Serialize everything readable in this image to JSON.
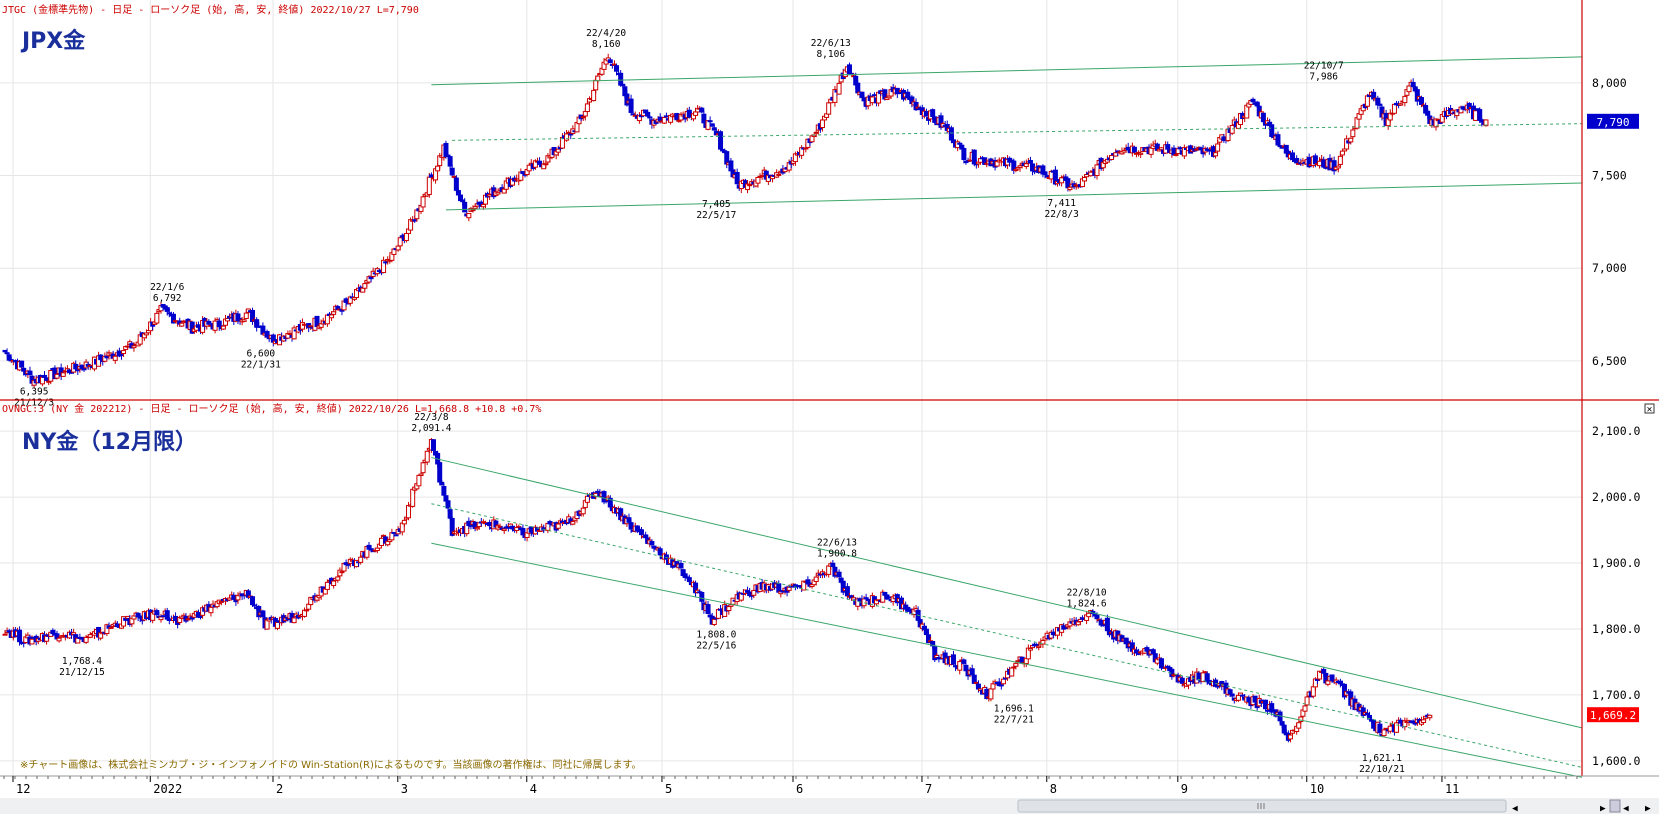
{
  "chart_data": [
    {
      "type": "candlestick",
      "header": "JTGC (金標準先物) - 日足 - ローソク足 (始, 高, 安, 終値)  2022/10/27 L=7,790",
      "title": "JPX金",
      "ylim": [
        6300,
        8350
      ],
      "yticks": [
        "8,000",
        "7,500",
        "7,000",
        "6,500"
      ],
      "ytick_values": [
        8000,
        7500,
        7000,
        6500
      ],
      "last_label": "7,790",
      "last_value": 7790,
      "anchors": [
        {
          "x": 0,
          "y": 6550
        },
        {
          "x": 14,
          "y": 6395
        },
        {
          "x": 40,
          "y": 6480
        },
        {
          "x": 63,
          "y": 6590
        },
        {
          "x": 75,
          "y": 6770
        },
        {
          "x": 90,
          "y": 6680
        },
        {
          "x": 103,
          "y": 6700
        },
        {
          "x": 117,
          "y": 6760
        },
        {
          "x": 128,
          "y": 6620
        },
        {
          "x": 134,
          "y": 6640
        },
        {
          "x": 152,
          "y": 6720
        },
        {
          "x": 166,
          "y": 6820
        },
        {
          "x": 185,
          "y": 7050
        },
        {
          "x": 196,
          "y": 7250
        },
        {
          "x": 211,
          "y": 7650
        },
        {
          "x": 221,
          "y": 7300
        },
        {
          "x": 240,
          "y": 7450
        },
        {
          "x": 262,
          "y": 7600
        },
        {
          "x": 277,
          "y": 7800
        },
        {
          "x": 290,
          "y": 8160
        },
        {
          "x": 301,
          "y": 7850
        },
        {
          "x": 312,
          "y": 7800
        },
        {
          "x": 333,
          "y": 7850
        },
        {
          "x": 343,
          "y": 7700
        },
        {
          "x": 352,
          "y": 7450
        },
        {
          "x": 377,
          "y": 7550
        },
        {
          "x": 391,
          "y": 7750
        },
        {
          "x": 405,
          "y": 8100
        },
        {
          "x": 413,
          "y": 7900
        },
        {
          "x": 430,
          "y": 7950
        },
        {
          "x": 453,
          "y": 7750
        },
        {
          "x": 462,
          "y": 7600
        },
        {
          "x": 495,
          "y": 7540
        },
        {
          "x": 515,
          "y": 7430
        },
        {
          "x": 535,
          "y": 7650
        },
        {
          "x": 560,
          "y": 7640
        },
        {
          "x": 580,
          "y": 7620
        },
        {
          "x": 600,
          "y": 7900
        },
        {
          "x": 617,
          "y": 7600
        },
        {
          "x": 640,
          "y": 7550
        },
        {
          "x": 656,
          "y": 7940
        },
        {
          "x": 664,
          "y": 7800
        },
        {
          "x": 676,
          "y": 7986
        },
        {
          "x": 686,
          "y": 7780
        },
        {
          "x": 700,
          "y": 7870
        },
        {
          "x": 712,
          "y": 7800
        }
      ],
      "annotations": [
        {
          "x": 14,
          "y": 6395,
          "pos": "below",
          "lines": [
            "6,395",
            "21/12/3"
          ]
        },
        {
          "x": 78,
          "y": 6792,
          "pos": "above",
          "lines": [
            "22/1/6",
            "6,792"
          ]
        },
        {
          "x": 123,
          "y": 6600,
          "pos": "below",
          "lines": [
            "6,600",
            "22/1/31"
          ]
        },
        {
          "x": 289,
          "y": 8160,
          "pos": "above",
          "lines": [
            "22/4/20",
            "8,160"
          ]
        },
        {
          "x": 342,
          "y": 7405,
          "pos": "below",
          "lines": [
            "7,405",
            "22/5/17"
          ]
        },
        {
          "x": 397,
          "y": 8106,
          "pos": "above",
          "lines": [
            "22/6/13",
            "8,106"
          ]
        },
        {
          "x": 508,
          "y": 7411,
          "pos": "below",
          "lines": [
            "7,411",
            "22/8/3"
          ]
        },
        {
          "x": 634,
          "y": 7986,
          "pos": "above",
          "lines": [
            "22/10/7",
            "7,986"
          ]
        }
      ]
    },
    {
      "type": "candlestick",
      "header": "OVNGC:3 (NY 金 202212) - 日足 - ローソク足 (始, 高, 安, 終値)  2022/10/26 L=1,668.8 +10.8  +0.7%",
      "title": "NY金（12月限）",
      "ylim": [
        1580,
        2120
      ],
      "yticks": [
        "2,100.0",
        "2,000.0",
        "1,900.0",
        "1,800.0",
        "1,700.0",
        "1,600.0"
      ],
      "ytick_values": [
        2100,
        2000,
        1900,
        1800,
        1700,
        1600
      ],
      "last_label": "1,669.2",
      "last_value": 1669.2,
      "anchors": [
        {
          "x": 0,
          "y": 1800
        },
        {
          "x": 10,
          "y": 1782
        },
        {
          "x": 28,
          "y": 1795
        },
        {
          "x": 38,
          "y": 1782
        },
        {
          "x": 55,
          "y": 1810
        },
        {
          "x": 75,
          "y": 1825
        },
        {
          "x": 83,
          "y": 1808
        },
        {
          "x": 100,
          "y": 1835
        },
        {
          "x": 117,
          "y": 1855
        },
        {
          "x": 125,
          "y": 1805
        },
        {
          "x": 140,
          "y": 1820
        },
        {
          "x": 158,
          "y": 1880
        },
        {
          "x": 175,
          "y": 1920
        },
        {
          "x": 190,
          "y": 1950
        },
        {
          "x": 205,
          "y": 2085
        },
        {
          "x": 215,
          "y": 1950
        },
        {
          "x": 233,
          "y": 1960
        },
        {
          "x": 250,
          "y": 1945
        },
        {
          "x": 270,
          "y": 1960
        },
        {
          "x": 285,
          "y": 2010
        },
        {
          "x": 300,
          "y": 1960
        },
        {
          "x": 312,
          "y": 1925
        },
        {
          "x": 328,
          "y": 1880
        },
        {
          "x": 340,
          "y": 1815
        },
        {
          "x": 353,
          "y": 1850
        },
        {
          "x": 365,
          "y": 1865
        },
        {
          "x": 375,
          "y": 1860
        },
        {
          "x": 385,
          "y": 1865
        },
        {
          "x": 397,
          "y": 1895
        },
        {
          "x": 407,
          "y": 1840
        },
        {
          "x": 425,
          "y": 1850
        },
        {
          "x": 438,
          "y": 1825
        },
        {
          "x": 447,
          "y": 1760
        },
        {
          "x": 460,
          "y": 1745
        },
        {
          "x": 472,
          "y": 1700
        },
        {
          "x": 485,
          "y": 1740
        },
        {
          "x": 497,
          "y": 1780
        },
        {
          "x": 512,
          "y": 1810
        },
        {
          "x": 523,
          "y": 1824
        },
        {
          "x": 537,
          "y": 1780
        },
        {
          "x": 552,
          "y": 1760
        },
        {
          "x": 565,
          "y": 1720
        },
        {
          "x": 577,
          "y": 1730
        },
        {
          "x": 590,
          "y": 1700
        },
        {
          "x": 610,
          "y": 1680
        },
        {
          "x": 617,
          "y": 1630
        },
        {
          "x": 623,
          "y": 1670
        },
        {
          "x": 632,
          "y": 1730
        },
        {
          "x": 640,
          "y": 1720
        },
        {
          "x": 650,
          "y": 1680
        },
        {
          "x": 662,
          "y": 1645
        },
        {
          "x": 675,
          "y": 1660
        },
        {
          "x": 685,
          "y": 1669
        }
      ],
      "annotations": [
        {
          "x": 205,
          "y": 2091.4,
          "pos": "above",
          "lines": [
            "22/3/8",
            "2,091.4"
          ]
        },
        {
          "x": 342,
          "y": 1808,
          "pos": "below",
          "lines": [
            "1,808.0",
            "22/5/16"
          ]
        },
        {
          "x": 400,
          "y": 1900.8,
          "pos": "above",
          "lines": [
            "22/6/13",
            "1,900.8"
          ]
        },
        {
          "x": 520,
          "y": 1824.6,
          "pos": "above",
          "lines": [
            "22/8/10",
            "1,824.6"
          ]
        },
        {
          "x": 485,
          "y": 1696.1,
          "pos": "below",
          "lines": [
            "1,696.1",
            "22/7/21"
          ]
        },
        {
          "x": 662,
          "y": 1621.1,
          "pos": "below",
          "lines": [
            "1,621.1",
            "22/10/21"
          ]
        },
        {
          "x": 37,
          "y": 1768.4,
          "pos": "below",
          "lines": [
            "1,768.4",
            "21/12/15"
          ]
        }
      ]
    }
  ],
  "x_axis": {
    "labels": [
      "12",
      "2022",
      "2",
      "3",
      "4",
      "5",
      "6",
      "7",
      "8",
      "9",
      "10",
      "11"
    ],
    "positions": [
      0,
      66,
      125,
      185,
      247,
      312,
      375,
      437,
      497,
      560,
      622,
      687
    ]
  },
  "copyright": "※チャート画像は、株式会社ミンカブ・ジ・インフォノイドの Win-Station(R)によるものです。当該画像の著作権は、同社に帰属します。",
  "colors": {
    "up": "#cc0000",
    "down": "#0000cc",
    "channel": "#3aa66a",
    "frame": "#cc0000",
    "label_jpx": "#0000cc",
    "label_ny": "#ff0000"
  }
}
